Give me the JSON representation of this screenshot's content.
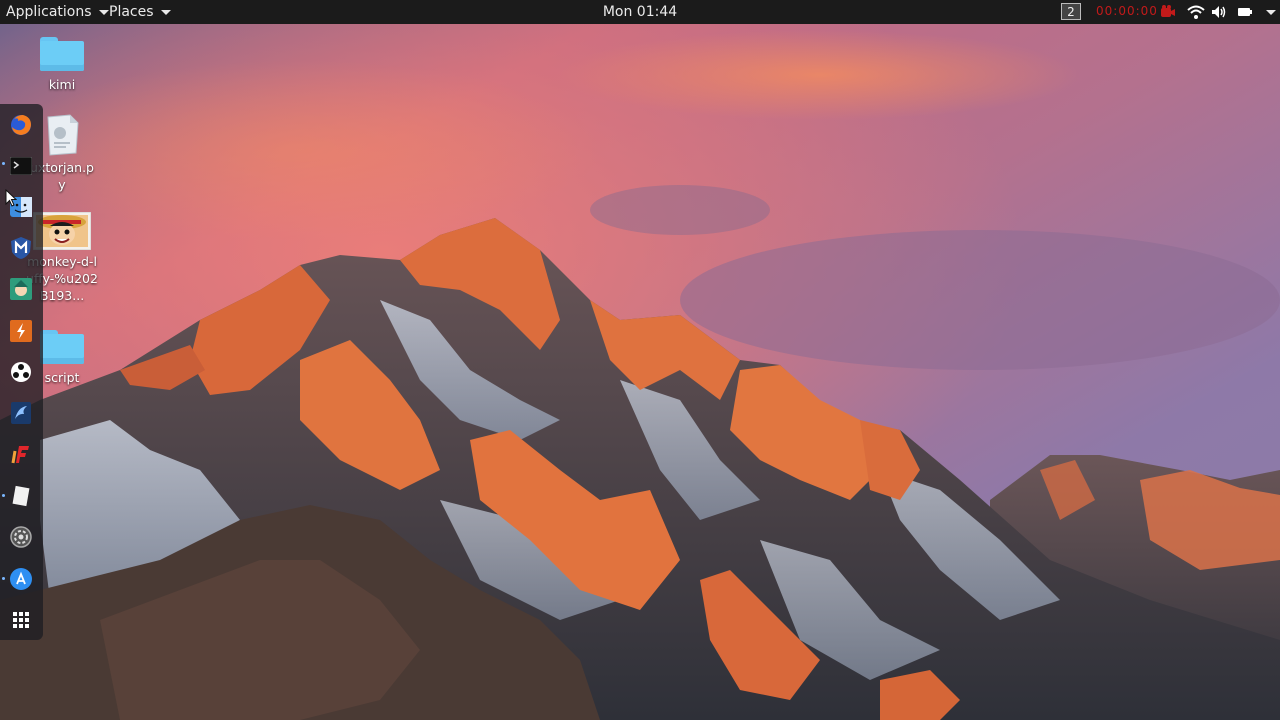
{
  "top_panel": {
    "applications_label": "Applications",
    "places_label": "Places",
    "clock": "Mon 01:44",
    "workspace_number": "2",
    "recording_timer": "00:00:00"
  },
  "desktop_icons": [
    {
      "label": "kimi",
      "icon": "folder-icon"
    },
    {
      "label": "uxtorjan.py",
      "icon": "python-file-icon"
    },
    {
      "label": "monkey-d-luffy-%u202B193...",
      "icon": "image-thumbnail-icon"
    },
    {
      "label": "script",
      "icon": "folder-icon"
    }
  ],
  "dock": {
    "items": [
      "firefox-icon",
      "terminal-icon",
      "finder-icon",
      "metasploit-icon",
      "anime-app-icon",
      "burpsuite-icon",
      "maltego-icon",
      "kali-tool-icon",
      "faraday-icon",
      "text-editor-icon",
      "settings-icon",
      "app-store-icon",
      "app-grid-icon"
    ]
  },
  "colors": {
    "panel_bg": "#1b1b1b",
    "folder_blue": "#6ccdf6",
    "recording_red": "#c21a1a",
    "sky_top": "#4b4a74",
    "sky_pink": "#e0787e",
    "rock_orange": "#d8683a"
  }
}
